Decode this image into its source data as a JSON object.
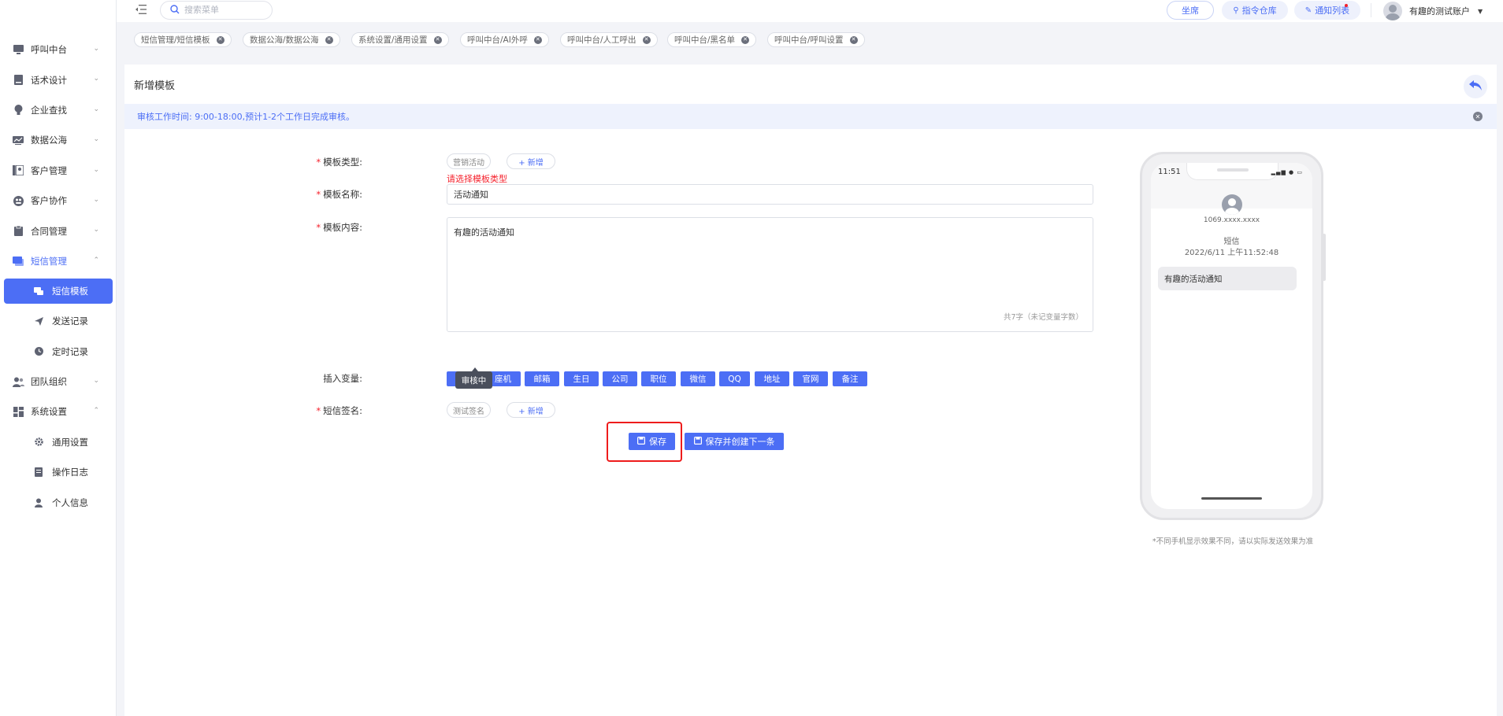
{
  "sidebar": {
    "items": [
      {
        "label": "呼叫中台",
        "icon": "monitor-icon"
      },
      {
        "label": "话术设计",
        "icon": "book-icon"
      },
      {
        "label": "企业查找",
        "icon": "lightbulb-icon"
      },
      {
        "label": "数据公海",
        "icon": "chart-icon"
      },
      {
        "label": "客户管理",
        "icon": "contacts-icon"
      },
      {
        "label": "客户协作",
        "icon": "collaborate-icon"
      },
      {
        "label": "合同管理",
        "icon": "clipboard-icon"
      },
      {
        "label": "短信管理",
        "icon": "message-icon",
        "expanded": true
      },
      {
        "label": "团队组织",
        "icon": "team-icon"
      },
      {
        "label": "系统设置",
        "icon": "dashboard-icon",
        "expanded": true
      }
    ],
    "sms_children": [
      {
        "label": "短信模板",
        "icon": "chat-icon",
        "active": true
      },
      {
        "label": "发送记录",
        "icon": "send-icon"
      },
      {
        "label": "定时记录",
        "icon": "clock-icon"
      }
    ],
    "system_children": [
      {
        "label": "通用设置",
        "icon": "gear-icon"
      },
      {
        "label": "操作日志",
        "icon": "log-icon"
      },
      {
        "label": "个人信息",
        "icon": "person-icon"
      }
    ]
  },
  "topbar": {
    "search_placeholder": "搜索菜单",
    "seat_label": "坐席",
    "command_label": "指令仓库",
    "notify_label": "通知列表",
    "user_name": "有趣的测试账户"
  },
  "tags": [
    "短信管理/短信模板",
    "数据公海/数据公海",
    "系统设置/通用设置",
    "呼叫中台/AI外呼",
    "呼叫中台/人工呼出",
    "呼叫中台/黑名单",
    "呼叫中台/呼叫设置"
  ],
  "page": {
    "title": "新增模板",
    "notice": "审核工作时间: 9:00-18:00,预计1-2个工作日完成审核。"
  },
  "form": {
    "type_label": "模板类型:",
    "type_value": "营销活动",
    "add_label": "+ 新增",
    "type_error": "请选择模板类型",
    "name_label": "模板名称:",
    "name_value": "活动通知",
    "content_label": "模板内容:",
    "content_value": "有趣的活动通知",
    "count_text": "共7字（未记变量字数）",
    "var_label": "插入变量:",
    "variables": [
      "",
      "座机",
      "邮箱",
      "生日",
      "公司",
      "职位",
      "微信",
      "QQ",
      "地址",
      "官网",
      "备注"
    ],
    "tooltip": "审核中",
    "sign_label": "短信签名:",
    "sign_value": "测试签名",
    "sign_add": "+ 新增",
    "save_label": "保存",
    "save_next_label": "保存并创建下一条"
  },
  "phone": {
    "time": "11:51",
    "number": "1069.xxxx.xxxx",
    "sender": "短信",
    "date": "2022/6/11 上午11:52:48",
    "message": "有趣的活动通知",
    "note": "*不同手机显示效果不同，请以实际发送效果为准"
  },
  "colors": {
    "accent": "#4c6ef5",
    "error": "#f5222d",
    "highlight": "#ee1c1c"
  }
}
